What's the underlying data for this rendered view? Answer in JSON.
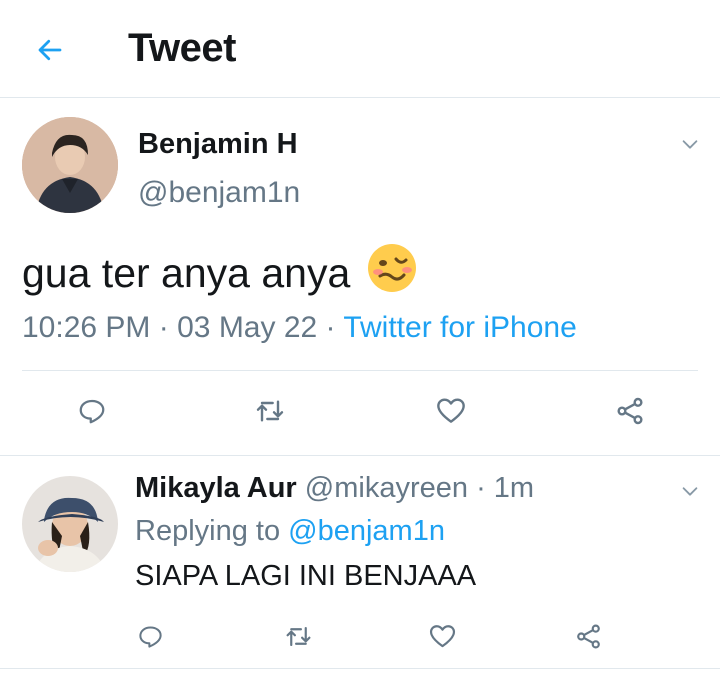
{
  "header": {
    "title": "Tweet",
    "back_icon": "arrow-left-icon",
    "accent": "#1da1f2"
  },
  "tweet": {
    "author_name": "Benjamin H",
    "author_handle": "@benjam1n",
    "text": "gua ter anya anya",
    "emoji": "woozy-face-emoji",
    "time": "10:26 PM",
    "separator": "·",
    "date": "03 May 22",
    "source": "Twitter for iPhone",
    "actions": [
      "reply-icon",
      "retweet-icon",
      "like-icon",
      "share-icon"
    ]
  },
  "reply": {
    "author_name": "Mikayla Aur",
    "author_handle": "@mikayreen",
    "separator": "·",
    "time": "1m",
    "replying_label": "Replying to",
    "replying_to": "@benjam1n",
    "text": "SIAPA LAGI INI BENJAAA",
    "actions": [
      "reply-icon",
      "retweet-icon",
      "like-icon",
      "share-icon"
    ]
  },
  "colors": {
    "text": "#14171a",
    "secondary": "#657786",
    "link": "#1da1f2",
    "border": "#e1e8ed"
  }
}
